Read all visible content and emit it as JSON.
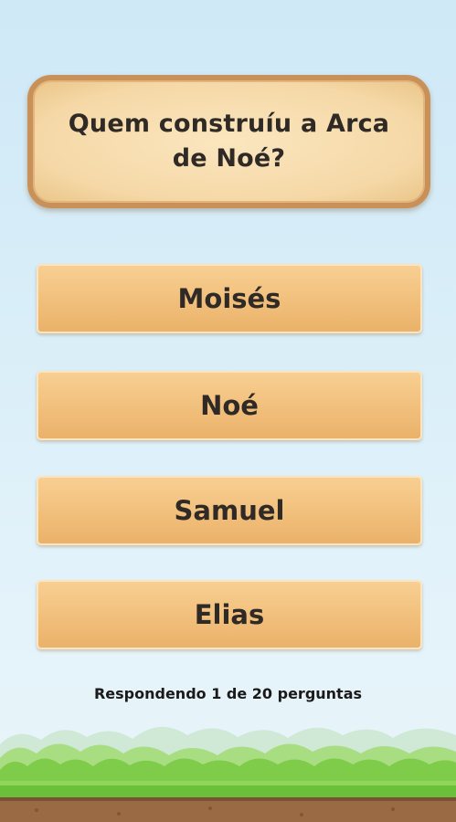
{
  "question": {
    "text": "Quem construíu a Arca de Noé?"
  },
  "answers": [
    {
      "label": "Moisés"
    },
    {
      "label": "Noé"
    },
    {
      "label": "Samuel"
    },
    {
      "label": "Elias"
    }
  ],
  "progress": {
    "text": "Respondendo 1 de 20 perguntas"
  },
  "colors": {
    "sky": "#d9eef8",
    "card_fill": "#f5d8a6",
    "card_border": "#c9915a",
    "button_fill": "#f1bf7b",
    "grass": "#72c53e",
    "soil": "#9a6a44"
  }
}
